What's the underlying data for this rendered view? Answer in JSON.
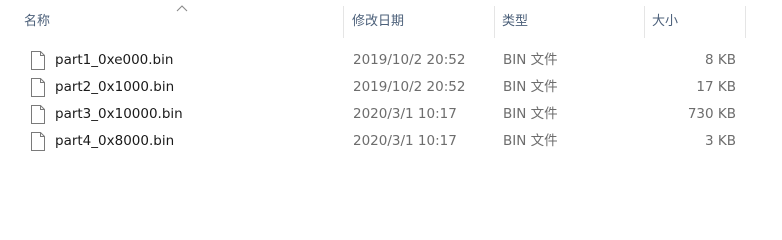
{
  "columns": {
    "name": "名称",
    "date": "修改日期",
    "type": "类型",
    "size": "大小"
  },
  "sort": {
    "column": "name",
    "direction": "ascending",
    "icon": "chevron-up-icon"
  },
  "files": [
    {
      "icon": "file-icon",
      "name": "part1_0xe000.bin",
      "date": "2019/10/2 20:52",
      "type": "BIN 文件",
      "size": "8 KB"
    },
    {
      "icon": "file-icon",
      "name": "part2_0x1000.bin",
      "date": "2019/10/2 20:52",
      "type": "BIN 文件",
      "size": "17 KB"
    },
    {
      "icon": "file-icon",
      "name": "part3_0x10000.bin",
      "date": "2020/3/1 10:17",
      "type": "BIN 文件",
      "size": "730 KB"
    },
    {
      "icon": "file-icon",
      "name": "part4_0x8000.bin",
      "date": "2020/3/1 10:17",
      "type": "BIN 文件",
      "size": "3 KB"
    }
  ],
  "colors": {
    "header_text": "#4c607a",
    "secondary_text": "#6d6d6d",
    "primary_text": "#1a1a1a",
    "divider": "#e5e5e5"
  }
}
